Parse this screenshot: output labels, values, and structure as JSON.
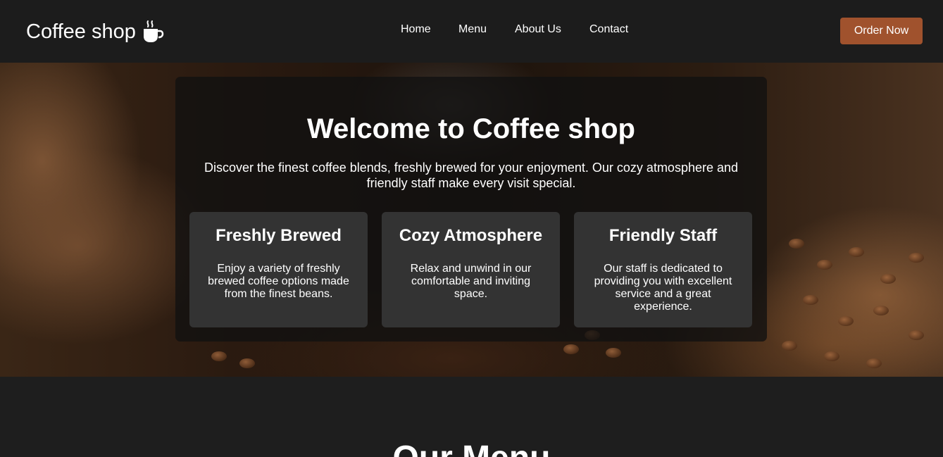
{
  "brand": {
    "name": "Coffee shop",
    "icon": "coffee-cup-icon"
  },
  "nav": {
    "items": [
      {
        "label": "Home"
      },
      {
        "label": "Menu"
      },
      {
        "label": "About Us"
      },
      {
        "label": "Contact"
      }
    ],
    "cta_label": "Order Now"
  },
  "hero": {
    "title": "Welcome to Coffee shop",
    "subtitle": "Discover the finest coffee blends, freshly brewed for your enjoyment. Our cozy atmosphere and friendly staff make every visit special.",
    "features": [
      {
        "title": "Freshly Brewed",
        "text": "Enjoy a variety of freshly brewed coffee options made from the finest beans."
      },
      {
        "title": "Cozy Atmosphere",
        "text": "Relax and unwind in our comfortable and inviting space."
      },
      {
        "title": "Friendly Staff",
        "text": "Our staff is dedicated to providing you with excellent service and a great experience."
      }
    ]
  },
  "menu_section": {
    "heading": "Our Menu"
  },
  "colors": {
    "background": "#1e1e1e",
    "navbar": "#1c1c1c",
    "accent": "#a0522d",
    "card": "#333333",
    "text": "#ffffff"
  }
}
